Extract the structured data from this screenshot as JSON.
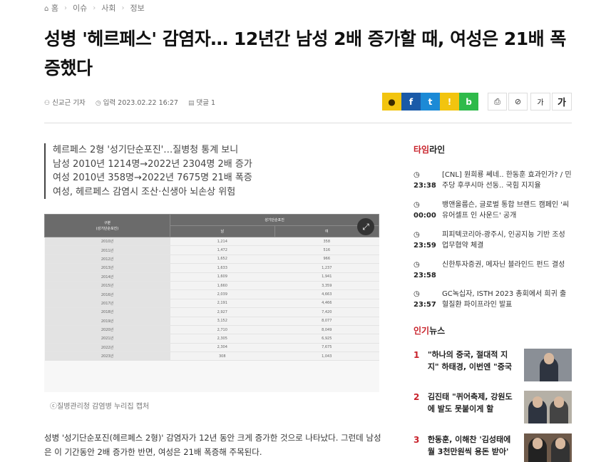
{
  "breadcrumb": {
    "home": "홈",
    "items": [
      "이슈",
      "사회",
      "정보"
    ]
  },
  "title": "성병 '헤르페스' 감염자… 12년간 남성 2배 증가할 때, 여성은 21배 폭증했다",
  "meta": {
    "author": "신교근 기자",
    "date": "입력 2023.02.22 16:27",
    "comments": "댓글 1"
  },
  "share": [
    {
      "name": "kakaotalk",
      "color": "#f2c40f",
      "glyph": "●"
    },
    {
      "name": "facebook",
      "color": "#1a5aa8",
      "glyph": "f"
    },
    {
      "name": "twitter",
      "color": "#1c8ad6",
      "glyph": "t"
    },
    {
      "name": "kakaostory",
      "color": "#f2c40f",
      "glyph": "!"
    },
    {
      "name": "band",
      "color": "#2fba4a",
      "glyph": "b"
    }
  ],
  "tools": {
    "print": "⎙",
    "link": "⊘",
    "font_small": "가",
    "font_large": "가"
  },
  "summary": [
    "헤르페스 2형 '성기단순포진'…질병청 통계 보니",
    "남성 2010년 1214명→2022년 2304명 2배 증가",
    "여성 2010년 358명→2022년 7675명 21배 폭증",
    "여성, 헤르페스 감염시 조산·신생아 뇌손상 위험"
  ],
  "table": {
    "header_group": "구분\n(성기단순포진)",
    "header_main": "성기단순포진",
    "col_male": "남",
    "col_female": "여",
    "rows": [
      [
        "2010년",
        "1,214",
        "358"
      ],
      [
        "2011년",
        "1,472",
        "516"
      ],
      [
        "2012년",
        "1,652",
        "966"
      ],
      [
        "2013년",
        "1,633",
        "1,237"
      ],
      [
        "2014년",
        "1,609",
        "1,941"
      ],
      [
        "2015년",
        "1,660",
        "3,359"
      ],
      [
        "2016년",
        "2,039",
        "4,663"
      ],
      [
        "2017년",
        "2,191",
        "4,466"
      ],
      [
        "2018년",
        "2,927",
        "7,420"
      ],
      [
        "2019년",
        "3,152",
        "8,077"
      ],
      [
        "2020년",
        "2,710",
        "8,049"
      ],
      [
        "2021년",
        "2,305",
        "6,925"
      ],
      [
        "2022년",
        "2,304",
        "7,675"
      ],
      [
        "2023년",
        "308",
        "1,043"
      ]
    ]
  },
  "caption": "ⓒ질병관리청 감염병 누리집 캡처",
  "body": "성병 '성기단순포진(헤르페스 2형)' 감염자가 12년 동안 크게 증가한 것으로 나타났다. 그런데 남성은 이 기간동안 2배 증가한 반면, 여성은 21배 폭증해 주목된다.",
  "timeline": {
    "head_accent": "타임",
    "head_rest": "라인",
    "items": [
      {
        "time": "23:38",
        "text": "[CNL] 원희룡 쎄네.. 한동훈 효과인가? / 민주당 후쿠시마 선동.. 국힘 지지율"
      },
      {
        "time": "00:00",
        "text": "뱅앤올룹슨, 글로벌 통합 브랜드 캠페인 '씨 유어셀프 인 사운드' 공개"
      },
      {
        "time": "23:59",
        "text": "피피텍코리아-광주시, 인공지능 기반 조성 업무협약 체결"
      },
      {
        "time": "23:58",
        "text": "신한투자증권, 메자닌 블라인드 펀드 결성"
      },
      {
        "time": "23:57",
        "text": "GC녹십자, ISTH 2023 총회에서 희귀 출혈질환 파이프라인 발표"
      }
    ]
  },
  "popular": {
    "head_accent": "인기",
    "head_rest": "뉴스",
    "items": [
      {
        "rank": "1",
        "text": "\"하나의 중국, 절대적 지지\" 하태경, 이번엔 \"중국"
      },
      {
        "rank": "2",
        "text": "김진태 \"퀴어축제, 강원도에 발도 못붙이게 할"
      },
      {
        "rank": "3",
        "text": "한동훈, 이해찬 '김성태에 월 3천만원씩 용돈 받아'"
      }
    ]
  }
}
